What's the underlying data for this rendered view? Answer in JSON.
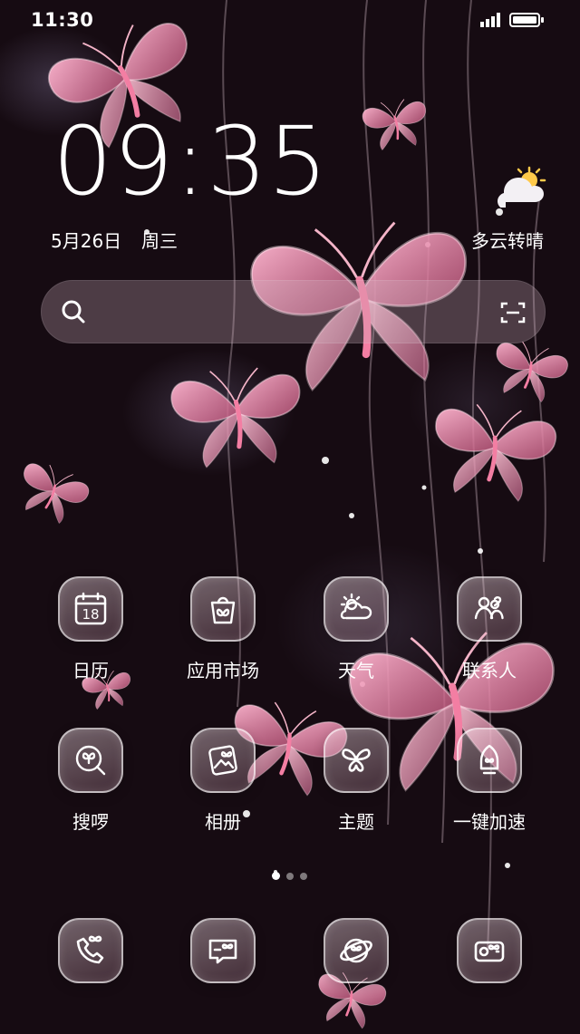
{
  "status_bar": {
    "time": "11:30"
  },
  "lockscreen": {
    "clock": "09:35",
    "date": "5月26日",
    "weekday": "周三",
    "weather": "多云转晴"
  },
  "search_bar": {
    "value": ""
  },
  "apps_row1": [
    {
      "label": "日历",
      "icon": "calendar-icon",
      "date_number": "18"
    },
    {
      "label": "应用市场",
      "icon": "app-store-icon"
    },
    {
      "label": "天气",
      "icon": "weather-icon"
    },
    {
      "label": "联系人",
      "icon": "contacts-icon"
    }
  ],
  "apps_row2": [
    {
      "label": "搜啰",
      "icon": "search-app-icon"
    },
    {
      "label": "相册",
      "icon": "gallery-icon"
    },
    {
      "label": "主题",
      "icon": "theme-icon"
    },
    {
      "label": "一键加速",
      "icon": "booster-icon"
    }
  ],
  "dock": [
    {
      "icon": "phone-icon"
    },
    {
      "icon": "messages-icon"
    },
    {
      "icon": "browser-icon"
    },
    {
      "icon": "camera-icon"
    }
  ],
  "page_indicator": {
    "pages": 3,
    "current": 1
  },
  "colors": {
    "background": "#1a0d15",
    "butterfly_pink": "#e58aa8",
    "icon_glass": "#d9a5b8"
  }
}
